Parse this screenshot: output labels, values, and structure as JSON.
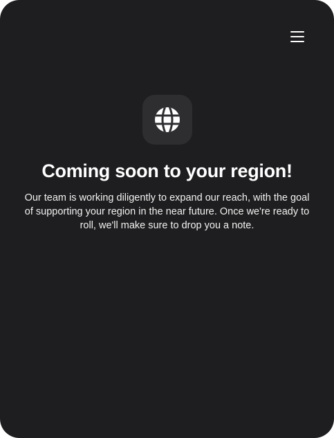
{
  "header": {
    "menu_icon": "hamburger-menu-icon"
  },
  "notice": {
    "icon": "globe-icon",
    "title": "Coming soon to your region!",
    "message": "Our team is working diligently to expand our reach, with the goal of supporting your region in the near future. Once we're ready to roll, we'll make sure to drop you a note."
  },
  "colors": {
    "background": "#1e1e20",
    "icon_tile": "#2e2e31",
    "text": "#ffffff"
  }
}
